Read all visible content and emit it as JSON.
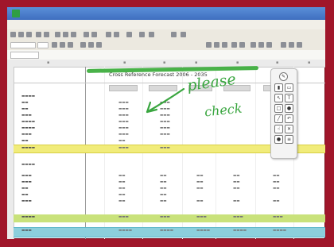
{
  "spreadsheet": {
    "title": "Cross Reference Forecast 2006 - 2035"
  },
  "annotation": {
    "text_line1": "please",
    "text_line2": "check"
  },
  "colors": {
    "background_frame": "#a0162a",
    "highlight_yellow": "#f1ec7a",
    "highlight_teal": "#8ccfdc",
    "annotation_green": "#3aa640"
  },
  "icons": {
    "app": "spreadsheet-app-icon",
    "palette_tools": [
      "pen-icon",
      "highlighter-icon",
      "eraser-icon",
      "select-icon",
      "text-icon",
      "shape-icon",
      "color-icon",
      "close-icon"
    ]
  }
}
